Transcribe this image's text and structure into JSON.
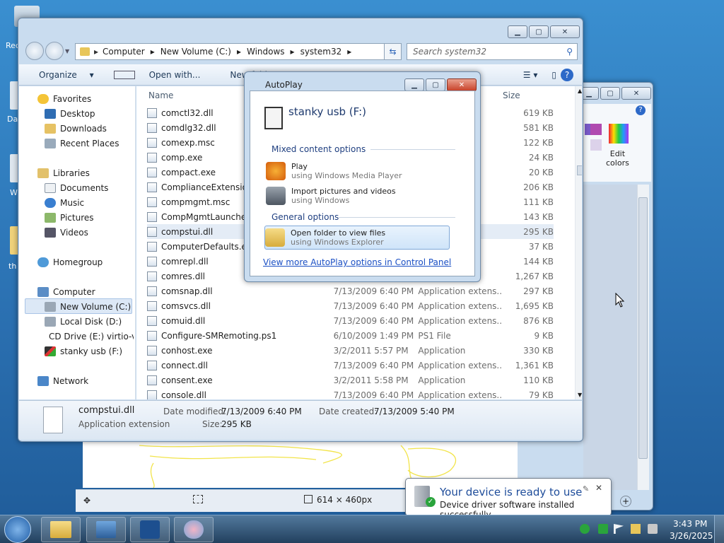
{
  "desktop": {
    "recycle_label": "Rec",
    "item2_label": "Da",
    "item3_label": "W",
    "item4_label": "th"
  },
  "explorer": {
    "breadcrumb": [
      "Computer",
      "New Volume (C:)",
      "Windows",
      "system32"
    ],
    "search_placeholder": "Search system32",
    "toolbar": {
      "organize": "Organize",
      "open_with": "Open with...",
      "new_folder": "New folder"
    },
    "nav": {
      "favorites": "Favorites",
      "desktop": "Desktop",
      "downloads": "Downloads",
      "recent": "Recent Places",
      "libraries": "Libraries",
      "documents": "Documents",
      "music": "Music",
      "pictures": "Pictures",
      "videos": "Videos",
      "homegroup": "Homegroup",
      "computer": "Computer",
      "new_volume": "New Volume (C:)",
      "local_disk": "Local Disk (D:)",
      "cd_drive": "CD Drive (E:) virtio-v",
      "usb": "stanky usb (F:)",
      "network": "Network"
    },
    "columns": {
      "name": "Name",
      "size": "Size"
    },
    "files": [
      {
        "name": "comctl32.dll",
        "date": "",
        "type": "ns...",
        "size": "619 KB"
      },
      {
        "name": "comdlg32.dll",
        "date": "",
        "type": "ns...",
        "size": "581 KB"
      },
      {
        "name": "comexp.msc",
        "date": "",
        "type": "",
        "size": "122 KB"
      },
      {
        "name": "comp.exe",
        "date": "",
        "type": "",
        "size": "24 KB"
      },
      {
        "name": "compact.exe",
        "date": "",
        "type": "",
        "size": "20 KB"
      },
      {
        "name": "ComplianceExtension",
        "date": "",
        "type": "",
        "size": "206 KB"
      },
      {
        "name": "compmgmt.msc",
        "date": "",
        "type": "",
        "size": "111 KB"
      },
      {
        "name": "CompMgmtLauncher",
        "date": "",
        "type": "",
        "size": "143 KB"
      },
      {
        "name": "compstui.dll",
        "date": "",
        "type": "ns...",
        "size": "295 KB"
      },
      {
        "name": "ComputerDefaults.exe",
        "date": "",
        "type": "",
        "size": "37 KB"
      },
      {
        "name": "comrepl.dll",
        "date": "",
        "type": "ns...",
        "size": "144 KB"
      },
      {
        "name": "comres.dll",
        "date": "",
        "type": "ns...",
        "size": "1,267 KB"
      },
      {
        "name": "comsnap.dll",
        "date": "7/13/2009 6:40 PM",
        "type": "Application extens...",
        "size": "297 KB"
      },
      {
        "name": "comsvcs.dll",
        "date": "7/13/2009 6:40 PM",
        "type": "Application extens...",
        "size": "1,695 KB"
      },
      {
        "name": "comuid.dll",
        "date": "7/13/2009 6:40 PM",
        "type": "Application extens...",
        "size": "876 KB"
      },
      {
        "name": "Configure-SMRemoting.ps1",
        "date": "6/10/2009 1:49 PM",
        "type": "PS1 File",
        "size": "9 KB"
      },
      {
        "name": "conhost.exe",
        "date": "3/2/2011 5:57 PM",
        "type": "Application",
        "size": "330 KB"
      },
      {
        "name": "connect.dll",
        "date": "7/13/2009 6:40 PM",
        "type": "Application extens...",
        "size": "1,361 KB"
      },
      {
        "name": "consent.exe",
        "date": "3/2/2011 5:58 PM",
        "type": "Application",
        "size": "110 KB"
      },
      {
        "name": "console.dll",
        "date": "7/13/2009 6:40 PM",
        "type": "Application extens...",
        "size": "79 KB"
      }
    ],
    "selected_index": 8,
    "details": {
      "filename": "compstui.dll",
      "filetype": "Application extension",
      "modified_label": "Date modified:",
      "modified_value": "7/13/2009 6:40 PM",
      "created_label": "Date created:",
      "created_value": "7/13/2009 5:40 PM",
      "size_label": "Size:",
      "size_value": "295 KB"
    }
  },
  "autoplay": {
    "title": "AutoPlay",
    "device": "stanky usb (F:)",
    "mixed_header": "Mixed content options",
    "play_title": "Play",
    "play_sub": "using Windows Media Player",
    "import_title": "Import pictures and videos",
    "import_sub": "using Windows",
    "general_header": "General options",
    "open_title": "Open folder to view files",
    "open_sub": "using Windows Explorer",
    "link": "View more AutoPlay options in Control Panel"
  },
  "paint": {
    "edit_colors": "Edit\ncolors",
    "dimensions": "614 × 460px"
  },
  "notification": {
    "title": "Your device is ready to use",
    "body": "Device driver software installed successfully."
  },
  "clock": {
    "time": "3:43 PM",
    "date": "3/26/2025"
  },
  "colors": {
    "accent": "#1f5b98",
    "link": "#1a4fc4",
    "close_red": "#c8432b"
  }
}
